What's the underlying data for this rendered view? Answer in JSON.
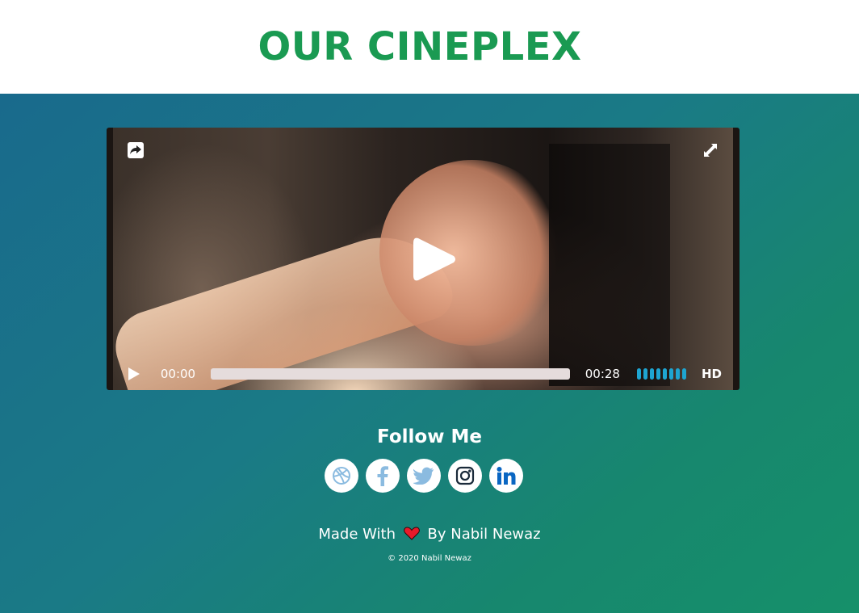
{
  "header": {
    "title": "OUR CINEPLEX"
  },
  "player": {
    "current_time": "00:00",
    "total_time": "00:28",
    "progress": 0,
    "volume_level": 1.0,
    "volume_bars": 8,
    "quality_label": "HD",
    "icons": {
      "share": "share-icon",
      "fullscreen": "expand-icon",
      "big_play": "play-icon",
      "play": "play-icon"
    }
  },
  "follow": {
    "title": "Follow Me",
    "socials": [
      {
        "name": "dribbble-icon",
        "color": "#8bbbe0"
      },
      {
        "name": "facebook-icon",
        "color": "#8bbbe0"
      },
      {
        "name": "twitter-icon",
        "color": "#8bbbe0"
      },
      {
        "name": "instagram-icon",
        "color": "#1a2a3a"
      },
      {
        "name": "linkedin-icon",
        "color": "#0a66c2"
      }
    ]
  },
  "footer": {
    "made_prefix": "Made With",
    "made_suffix": "By Nabil Newaz",
    "copyright": "© 2020 Nabil Newaz"
  },
  "colors": {
    "title_green": "#1a9a52",
    "volume_blue": "#1ea5d2",
    "heart_red": "#e81a2a"
  }
}
